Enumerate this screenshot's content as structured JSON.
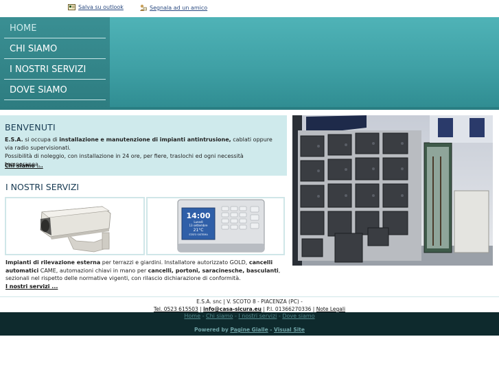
{
  "toplinks": {
    "outlook": "Salva su outlook",
    "friend": "Segnala ad un amico"
  },
  "nav": {
    "items": [
      "HOME",
      "CHI SIAMO",
      "I NOSTRI SERVIZI",
      "DOVE SIAMO"
    ]
  },
  "welcome": {
    "title": "BENVENUTI",
    "p1_a": "E.S.A.",
    "p1_b": " si occupa di ",
    "p1_c": "installazione e manutenzione di impianti antintrusione,",
    "p1_d": " cablati oppure via radio supervisionati.",
    "p2": "Possibilità di noleggio, con installazione in 24 ore, per fiere, traslochi ed ogni necessità temporanea.",
    "more": "Chi siamo ..."
  },
  "services": {
    "title": "I NOSTRI SERVIZI",
    "keypad": {
      "time": "14:00",
      "day": "Lunedì",
      "date": "13 settembre",
      "temp": "21°C",
      "state": "STATO SISTEMA"
    },
    "t1": "Impianti di rilevazione esterna",
    "t2": " per terrazzi e giardini. Installatore autorizzato GOLD, ",
    "t3": "cancelli automatici",
    "t4": " CAME, automazioni chiavi in mano per ",
    "t5": "cancelli, portoni, saracinesche, basculanti",
    "t6": ", sezionali nel rispetto delle normative vigenti, con rilascio dichiarazione di conformità.",
    "more": "I nostri servizi ..."
  },
  "footer": {
    "line1": "E.S.A. snc | V. SCOTO 8 - PIACENZA (PC) -",
    "tel": "Tel. 0523 615503",
    "sep1": " | ",
    "email": "info@casa-sicura.eu",
    "piva": " | P.I. 01366270336 | ",
    "legal": "Note Legali",
    "nav": [
      "Home",
      "Chi siamo",
      "I nostri servizi",
      "Dove siamo"
    ],
    "powered_label": "Powered by",
    "powered_1": "Pagine Gialle",
    "powered_sep": " - ",
    "powered_2": "Visual Site"
  },
  "colors": {
    "accent": "#3fa0a5",
    "nav": "#2d7c80",
    "footer": "#0e2a2d",
    "panel": "#cfeaec"
  }
}
